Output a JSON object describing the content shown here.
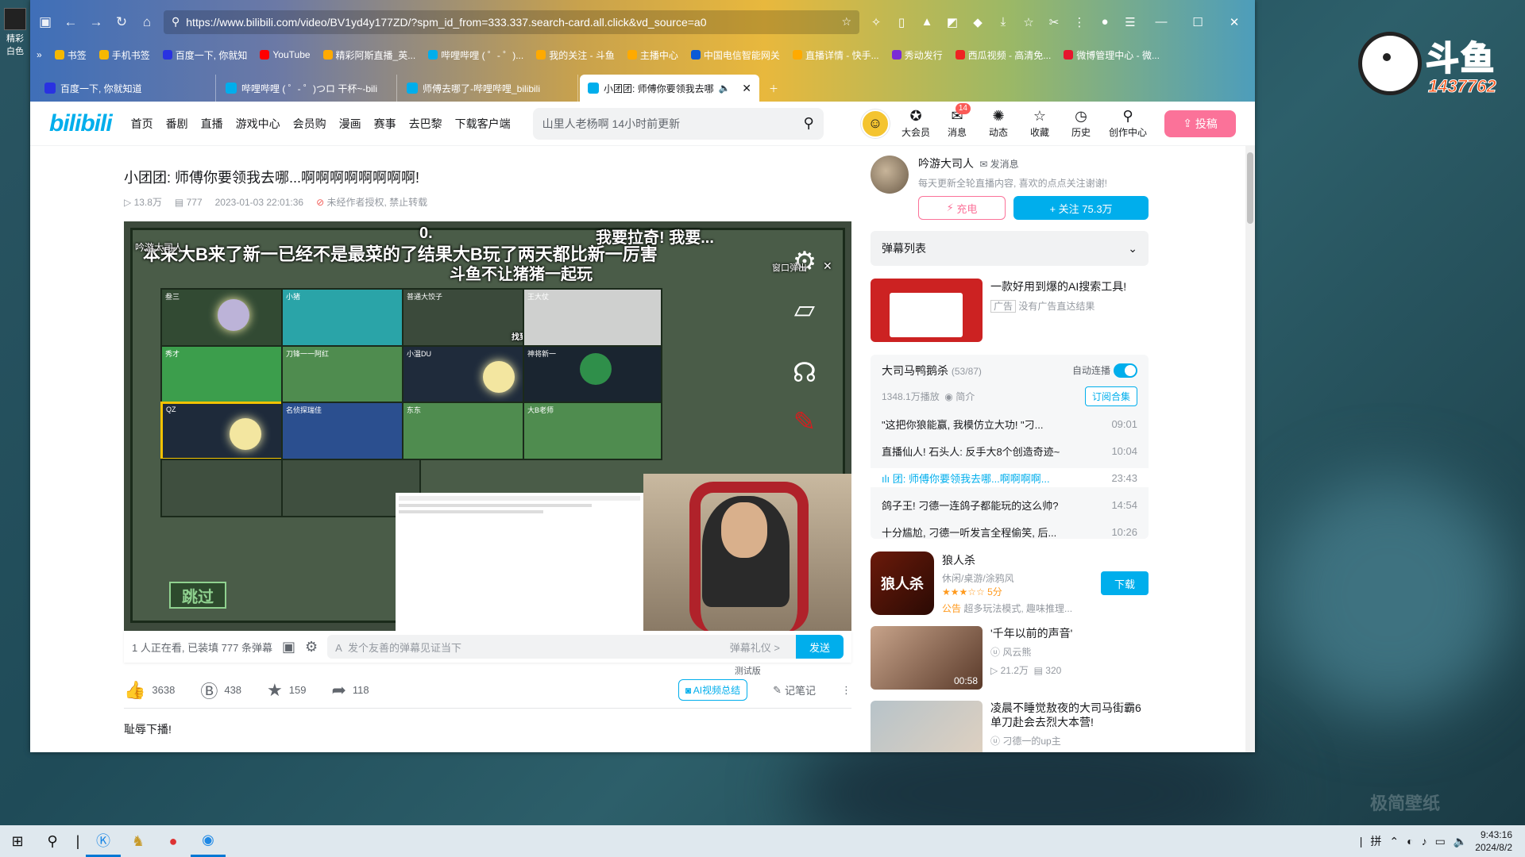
{
  "desktop": {
    "icon_label_1": "精彩",
    "icon_label_2": "白色",
    "watermark": "极简壁纸"
  },
  "douyu": {
    "logo_text": "斗鱼",
    "room_number": "1437762"
  },
  "browser": {
    "url": "https://www.bilibili.com/video/BV1yd4y177ZD/?spm_id_from=333.337.search-card.all.click&vd_source=a0",
    "bookmarks": [
      "书签",
      "手机书签",
      "百度一下, 你就知",
      "YouTube",
      "精彩阿斯直播_英...",
      "哔哩哔哩 ( ゜- ゜)...",
      "我的关注 - 斗鱼",
      "主播中心",
      "中国电信智能网关",
      "直播详情 - 快手...",
      "秀动发行",
      "西瓜视频 - 高清免...",
      "微博管理中心 - 微..."
    ],
    "tabs": [
      {
        "label": "百度一下, 你就知道"
      },
      {
        "label": "哔哩哔哩 ( ゜- ゜)つロ 干杯~-bili"
      },
      {
        "label": "师傅去哪了-哔哩哔哩_bilibili"
      },
      {
        "label": "小团团: 师傅你要领我去哪"
      }
    ]
  },
  "header": {
    "logo": "bilibili",
    "nav": [
      "首页",
      "番剧",
      "直播",
      "游戏中心",
      "会员购",
      "漫画",
      "赛事",
      "去巴黎",
      "下载客户端"
    ],
    "search_placeholder": "山里人老杨啊 14小时前更新",
    "actions": [
      {
        "label": "大会员",
        "icon": "vip-icon"
      },
      {
        "label": "消息",
        "icon": "message-icon",
        "badge": "14"
      },
      {
        "label": "动态",
        "icon": "dynamic-icon"
      },
      {
        "label": "收藏",
        "icon": "star-icon"
      },
      {
        "label": "历史",
        "icon": "history-icon"
      },
      {
        "label": "创作中心",
        "icon": "bulb-icon"
      }
    ],
    "upload": "投稿"
  },
  "video": {
    "title": "小团团: 师傅你要领我去哪...啊啊啊啊啊啊啊啊!",
    "views": "13.8万",
    "danmaku": "777",
    "date": "2023-01-03 22:01:36",
    "copyright": "未经作者授权, 禁止转载",
    "overlay": {
      "sub1": "本来大B来了新一已经不是最菜的了结果大B玩了两天都比新一厉害",
      "sub2": "斗鱼不让猪猪一起玩",
      "sub3": "我要拉奇! 我要...",
      "counter": "0.",
      "pop": "窗口弹出",
      "skip": "跳过",
      "found": "找到了",
      "corner": "吟游大司人"
    },
    "cells": [
      "叁三",
      "小猪",
      "普通大饺子",
      "王大仗",
      "秀才",
      "刀锋一一阿红",
      "小温DU",
      "神将新一",
      "QZ",
      "名侦探瑞佳",
      "东东",
      "大B老师"
    ]
  },
  "player_bar": {
    "watching": "1 人正在看, 已装填 777 条弹幕",
    "input_placeholder": "发个友善的弹幕见证当下",
    "etiquette": "弹幕礼仪 >",
    "send": "发送"
  },
  "toolbar": {
    "like": "3638",
    "coin": "438",
    "fav": "159",
    "share": "118",
    "ai": "AI视频总结",
    "ai_tag": "测试版",
    "notes": "记笔记"
  },
  "description": "耻辱下播!",
  "uploader": {
    "name": "吟游大司人",
    "msg": "发消息",
    "sign": "每天更新全轮直播内容, 喜欢的点点关注谢谢!",
    "charge": "充电",
    "follow": "+ 关注 75.3万"
  },
  "danmaku_list": "弹幕列表",
  "ad": {
    "title": "一款好用到爆的AI搜索工具!",
    "tag": "广告",
    "note": "没有广告直达结果"
  },
  "collection": {
    "title": "大司马鸭鹅杀",
    "count": "(53/87)",
    "autoplay": "自动连播",
    "plays": "1348.1万播放",
    "intro": "简介",
    "subscribe": "订阅合集",
    "episodes": [
      {
        "title": "\"这把你狼能赢, 我模仿立大功! \"刁...",
        "dur": "09:01"
      },
      {
        "title": "直播仙人! 石头人: 反手大8个创造奇迹~",
        "dur": "10:04"
      },
      {
        "title": "团: 师傅你要领我去哪...啊啊啊啊...",
        "dur": "23:43"
      },
      {
        "title": "鸽子王! 刁德一连鸽子都能玩的这么帅?",
        "dur": "14:54"
      },
      {
        "title": "十分尴尬, 刁德一听发言全程偷笑, 后...",
        "dur": "10:26"
      }
    ]
  },
  "game": {
    "name": "狼人杀",
    "tags": "休闲/桌游/涂鸦风",
    "score": "5分",
    "desc": "超多玩法模式, 趣味推理...",
    "badge": "公告",
    "download": "下载",
    "thumb_text": "狼人杀"
  },
  "recommend": [
    {
      "title": "'千年以前的声音'",
      "author": "风云熊",
      "views": "21.2万",
      "dm": "320",
      "dur": "00:58"
    },
    {
      "title": "凌晨不睡觉敖夜的大司马街霸6单刀赴会去烈大本营!",
      "author": "刁德一的up主"
    }
  ],
  "taskbar": {
    "time": "9:43:16",
    "date": "2024/8/2",
    "tray_ime": "拼"
  }
}
